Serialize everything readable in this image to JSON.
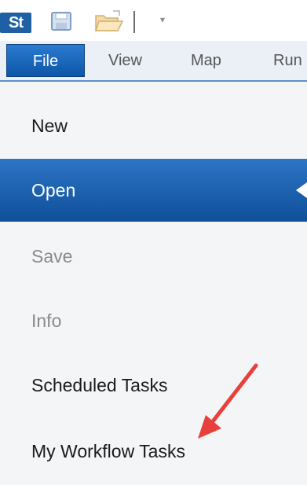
{
  "toolbar": {
    "app_logo_text": "St",
    "icons": [
      "app-logo",
      "save-icon",
      "open-folder-icon",
      "customize-dropdown-icon"
    ]
  },
  "tabs": [
    {
      "label": "File",
      "active": true
    },
    {
      "label": "View",
      "active": false
    },
    {
      "label": "Map",
      "active": false
    },
    {
      "label": "Run",
      "active": false
    }
  ],
  "menu": {
    "items": [
      {
        "label": "New",
        "state": "normal"
      },
      {
        "label": "Open",
        "state": "selected"
      },
      {
        "label": "Save",
        "state": "disabled"
      },
      {
        "label": "Info",
        "state": "disabled"
      },
      {
        "label": "Scheduled Tasks",
        "state": "normal"
      },
      {
        "label": "My Workflow Tasks",
        "state": "normal"
      }
    ]
  },
  "colors": {
    "accent": "#1f5fa3",
    "selected_bg": "#1a62b3",
    "annotation_arrow": "#e8403a"
  }
}
